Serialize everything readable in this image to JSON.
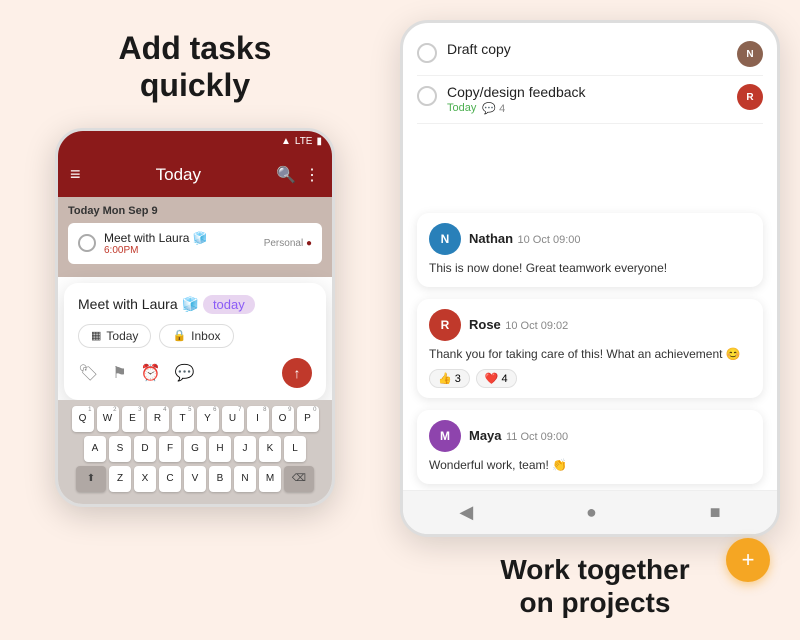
{
  "left": {
    "headline": "Add tasks\nquickly",
    "phone": {
      "status": "LTE",
      "header_title": "Today",
      "date_label": "Today  Mon Sep 9",
      "task": "Meet with Laura 🧊",
      "task_time": "6:00PM",
      "task_label": "Personal",
      "quick_add_text": "Meet with Laura 🧊",
      "today_tag": "today",
      "chip1_icon": "▦",
      "chip1_label": "Today",
      "chip2_icon": "🔒",
      "chip2_label": "Inbox",
      "keyboard_rows": [
        [
          "Q",
          "W",
          "E",
          "R",
          "T",
          "Y",
          "U",
          "I",
          "O",
          "P"
        ],
        [
          "A",
          "S",
          "D",
          "F",
          "G",
          "H",
          "J",
          "K",
          "L"
        ],
        [
          "Z",
          "X",
          "C",
          "V",
          "B",
          "N",
          "M"
        ]
      ],
      "key_nums": [
        "1",
        "2",
        "3",
        "4",
        "5",
        "6",
        "7",
        "8",
        "9",
        "0"
      ]
    }
  },
  "right": {
    "tasks": [
      {
        "title": "Draft copy",
        "meta": "",
        "has_avatar": true,
        "avatar_initials": "N",
        "avatar_color": "av-brown"
      },
      {
        "title": "Copy/design feedback",
        "meta_green": "Today",
        "meta_count": "4",
        "has_avatar": true,
        "avatar_initials": "R",
        "avatar_color": "av-red"
      }
    ],
    "comments": [
      {
        "name": "Nathan",
        "time": "10 Oct 09:00",
        "text": "This is now done! Great teamwork everyone!",
        "avatar_initials": "N",
        "avatar_color": "av-blue",
        "reactions": []
      },
      {
        "name": "Rose",
        "time": "10 Oct 09:02",
        "text": "Thank you for taking care of this! What an achievement 😊",
        "avatar_initials": "R",
        "avatar_color": "av-red",
        "reactions": [
          {
            "emoji": "👍",
            "count": "3"
          },
          {
            "emoji": "❤️",
            "count": "4"
          }
        ]
      },
      {
        "name": "Maya",
        "time": "11 Oct 09:00",
        "text": "Wonderful work, team! 👏",
        "avatar_initials": "M",
        "avatar_color": "av-purple",
        "reactions": []
      }
    ],
    "fab_label": "+",
    "bottom_text": "Work together\non projects",
    "nav": [
      "◀",
      "●",
      "■"
    ]
  }
}
